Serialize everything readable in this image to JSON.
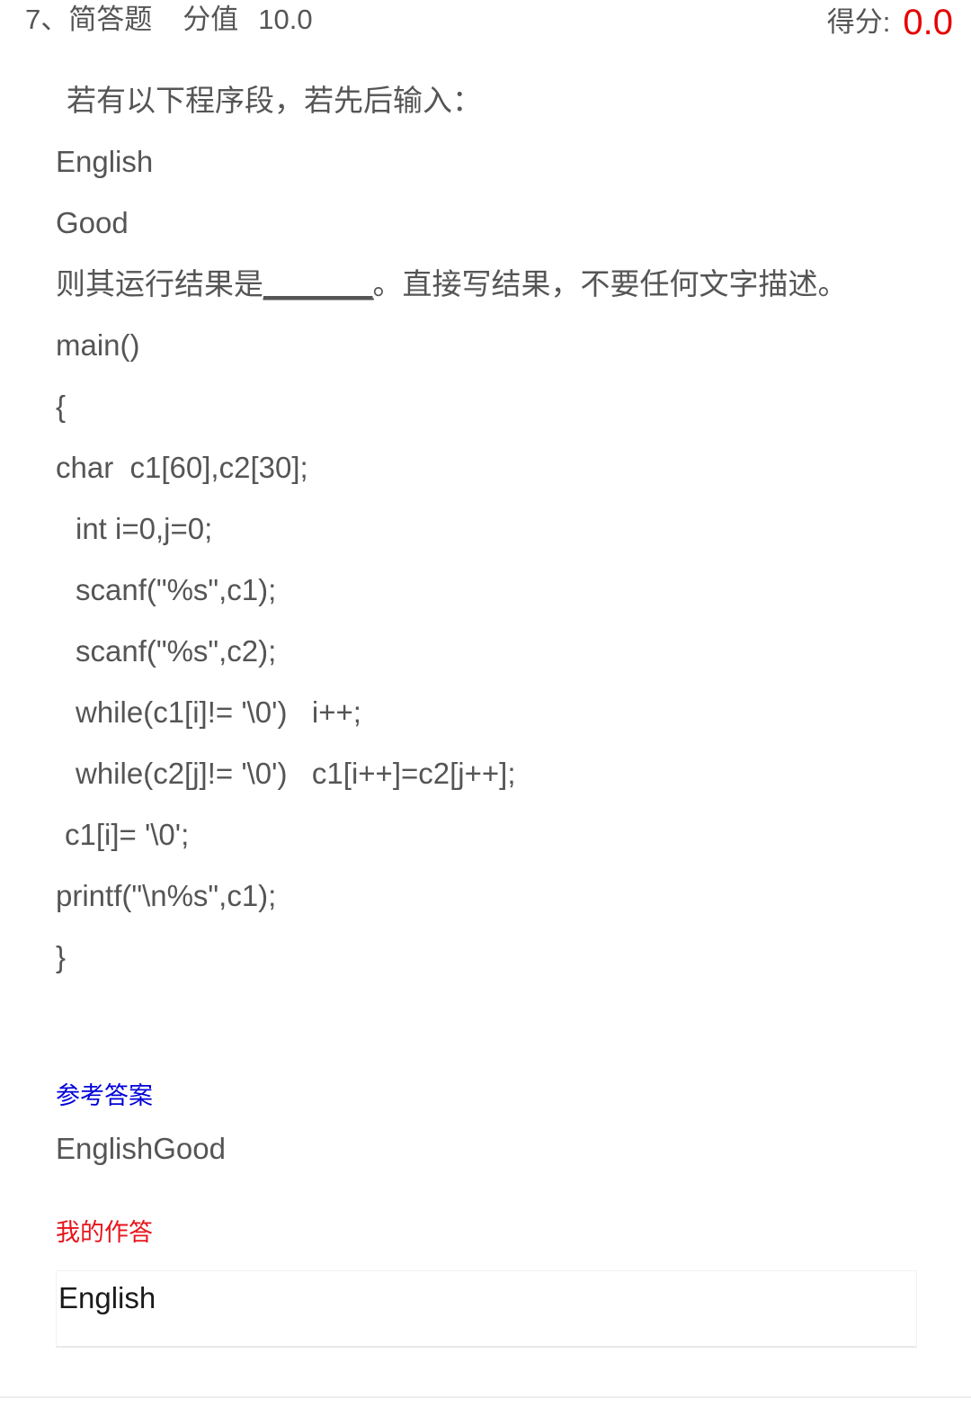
{
  "header": {
    "index": "7、",
    "type": "简答题",
    "score_label": "分值",
    "score_value": "10.0",
    "earned_label": "得分:",
    "earned_value": "0.0",
    "earned_color": "#e60000",
    "label_color": "#555555"
  },
  "question": {
    "prompt": "若有以下程序段，若先后输入：",
    "input_lines": [
      "English",
      "Good"
    ],
    "instruction_head": "则其运行结果是",
    "instruction_blank": "_______",
    "instruction_tail": "。直接写结果，不要任何文字描述。",
    "code_lines": [
      {
        "text": "main()",
        "indent": "ind1"
      },
      {
        "text": "{",
        "indent": "ind1"
      },
      {
        "text": "char  c1[60],c2[30];",
        "indent": "ind1"
      },
      {
        "text": "int i=0,j=0;",
        "indent": "ind3"
      },
      {
        "text": "scanf(\"%s\",c1);",
        "indent": "ind3"
      },
      {
        "text": "scanf(\"%s\",c2);",
        "indent": "ind3"
      },
      {
        "text": "while(c1[i]!= '\\0')   i++;",
        "indent": "ind3"
      },
      {
        "text": "while(c2[j]!= '\\0')   c1[i++]=c2[j++];",
        "indent": "ind3"
      },
      {
        "text": "c1[i]= '\\0';",
        "indent": "ind2"
      },
      {
        "text": "printf(\"\\n%s\",c1);",
        "indent": "ind1"
      },
      {
        "text": "}",
        "indent": "ind1"
      }
    ]
  },
  "reference_answer": {
    "label": "参考答案",
    "label_color": "#0000d9",
    "value": "EnglishGood"
  },
  "my_answer": {
    "label": "我的作答",
    "label_color": "#e8141b",
    "value": "English"
  }
}
